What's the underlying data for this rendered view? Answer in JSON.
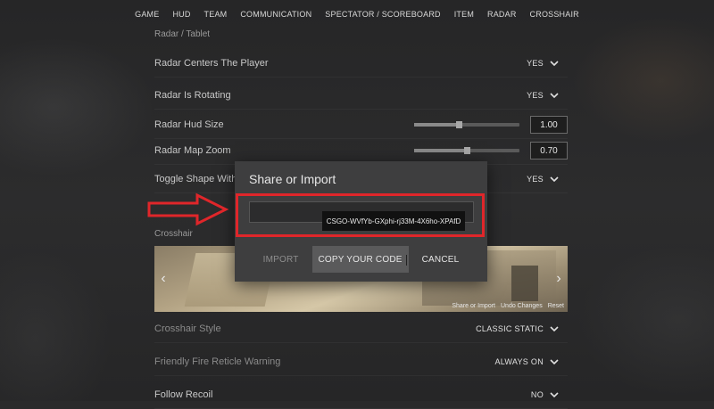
{
  "nav": {
    "items": [
      "GAME",
      "HUD",
      "TEAM",
      "COMMUNICATION",
      "SPECTATOR / SCOREBOARD",
      "ITEM",
      "RADAR",
      "CROSSHAIR"
    ]
  },
  "radar": {
    "section_title": "Radar / Tablet",
    "centers_player": {
      "label": "Radar Centers The Player",
      "value": "YES"
    },
    "is_rotating": {
      "label": "Radar Is Rotating",
      "value": "YES"
    },
    "hud_size": {
      "label": "Radar Hud Size",
      "value": "1.00",
      "level": 0.42
    },
    "map_zoom": {
      "label": "Radar Map Zoom",
      "value": "0.70",
      "level": 0.5
    },
    "toggle_shape": {
      "label": "Toggle Shape With S",
      "value": "YES"
    }
  },
  "crosshair": {
    "section_title": "Crosshair",
    "preview_links": {
      "share_or_import": "Share or Import",
      "undo_changes": "Undo Changes",
      "reset": "Reset"
    },
    "style": {
      "label": "Crosshair Style",
      "value": "CLASSIC STATIC"
    },
    "friendly_fire": {
      "label": "Friendly Fire Reticle Warning",
      "value": "ALWAYS ON"
    },
    "follow_recoil": {
      "label": "Follow Recoil",
      "value": "NO"
    }
  },
  "dialog": {
    "title": "Share or Import",
    "code_value": "",
    "tooltip": "CSGO-WVfYb-GXphi-rj33M-4X6ho-XPAfD",
    "import_label": "IMPORT",
    "copy_label": "COPY YOUR CODE",
    "cancel_label": "CANCEL"
  },
  "annotation": {
    "highlight_color": "#e0262a"
  },
  "colors": {
    "background": "#2a2a2b",
    "dialog_bg": "#3e3e3f",
    "text": "#cfcfcf"
  }
}
